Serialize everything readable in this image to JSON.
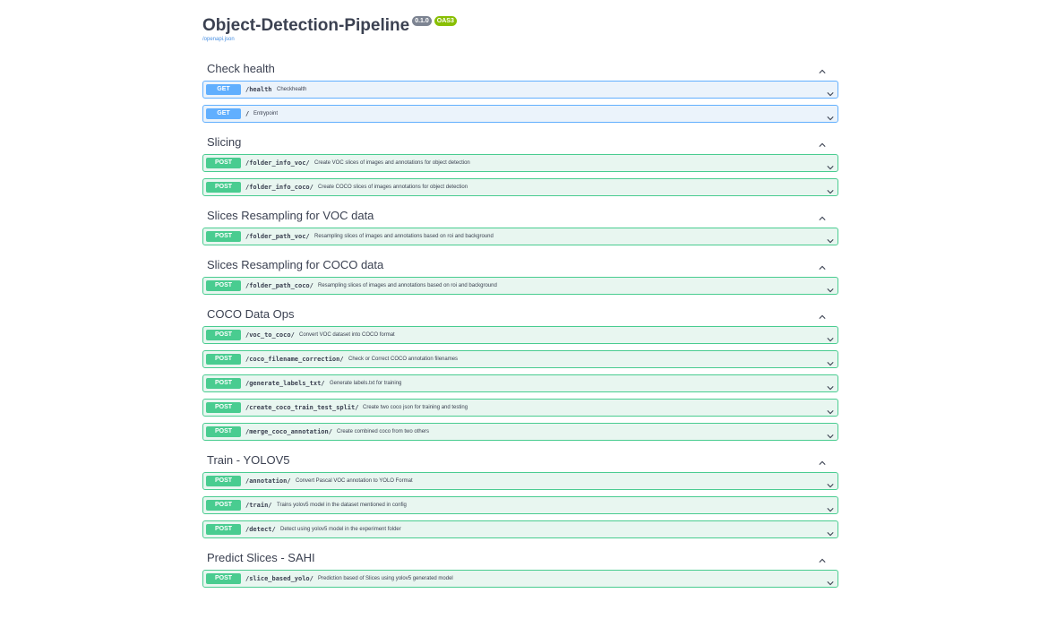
{
  "info": {
    "title": "Object-Detection-Pipeline",
    "version_badge": "0.1.0",
    "oas_badge": "OAS3",
    "spec_link": "/openapi.json"
  },
  "tags": [
    {
      "name": "Check health",
      "operations": [
        {
          "method": "GET",
          "path": "/health",
          "summary": "Checkhealth"
        },
        {
          "method": "GET",
          "path": "/",
          "summary": "Entrypoint"
        }
      ]
    },
    {
      "name": "Slicing",
      "operations": [
        {
          "method": "POST",
          "path": "/folder_info_voc/",
          "summary": "Create VOC slices of images and annotations for object detection"
        },
        {
          "method": "POST",
          "path": "/folder_info_coco/",
          "summary": "Create COCO slices of images annotations for object detection"
        }
      ]
    },
    {
      "name": "Slices Resampling for VOC data",
      "operations": [
        {
          "method": "POST",
          "path": "/folder_path_voc/",
          "summary": "Resampling slices of images and annotations based on roi and background"
        }
      ]
    },
    {
      "name": "Slices Resampling for COCO data",
      "operations": [
        {
          "method": "POST",
          "path": "/folder_path_coco/",
          "summary": "Resampling slices of images and annotations based on roi and background"
        }
      ]
    },
    {
      "name": "COCO Data Ops",
      "operations": [
        {
          "method": "POST",
          "path": "/voc_to_coco/",
          "summary": "Convert VOC dataset into COCO format"
        },
        {
          "method": "POST",
          "path": "/coco_filename_correction/",
          "summary": "Check or Correct COCO annotation filenames"
        },
        {
          "method": "POST",
          "path": "/generate_labels_txt/",
          "summary": "Generate labels.txt for training"
        },
        {
          "method": "POST",
          "path": "/create_coco_train_test_split/",
          "summary": "Create two coco json for training and testing"
        },
        {
          "method": "POST",
          "path": "/merge_coco_annotation/",
          "summary": "Create combined coco from two others"
        }
      ]
    },
    {
      "name": "Train - YOLOV5",
      "operations": [
        {
          "method": "POST",
          "path": "/annotation/",
          "summary": "Convert Pascal VOC annotation to YOLO Format"
        },
        {
          "method": "POST",
          "path": "/train/",
          "summary": "Trains yolov5 model in the dataset mentioned in config"
        },
        {
          "method": "POST",
          "path": "/detect/",
          "summary": "Detect using yolov5 model in the experiment folder"
        }
      ]
    },
    {
      "name": "Predict Slices - SAHI",
      "operations": [
        {
          "method": "POST",
          "path": "/slice_based_yolo/",
          "summary": "Prediction based of Slices using yolov5 generated model"
        }
      ]
    }
  ],
  "icons": {
    "tag_toggle": "chevron-up-icon",
    "op_toggle": "chevron-down-icon"
  },
  "colors": {
    "get": "#61affe",
    "post": "#49cc90",
    "get_bg": "#ebf3fb",
    "post_bg": "#e8f6f0"
  }
}
